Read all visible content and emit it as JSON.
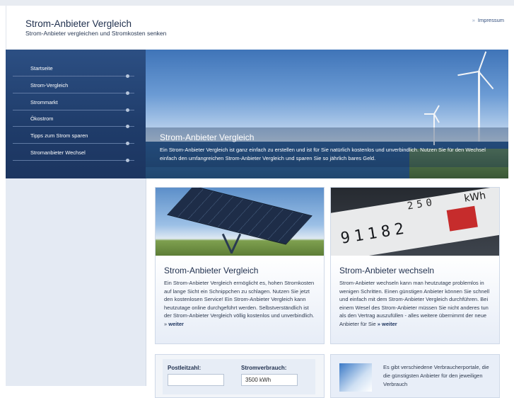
{
  "header": {
    "title": "Strom-Anbieter Vergleich",
    "subtitle": "Strom-Anbieter vergleichen und Stromkosten senken",
    "impressum_arrow": "»",
    "impressum": "Impressum"
  },
  "nav": {
    "items": [
      {
        "label": "Startseite"
      },
      {
        "label": "Strom-Vergleich"
      },
      {
        "label": "Strommarkt"
      },
      {
        "label": "Ökostrom"
      },
      {
        "label": "Tipps zum Strom sparen"
      },
      {
        "label": "Stromanbieter Wechsel"
      }
    ]
  },
  "hero": {
    "title": "Strom-Anbieter Vergleich",
    "text": "Ein Strom-Anbieter Vergleich ist ganz einfach zu erstellen und ist für Sie natürlich kostenlos und unverbindlich. Nutzen Sie für den Wechsel einfach den umfangreichen Strom-Anbieter Vergleich und sparen Sie so jährlich bares Geld."
  },
  "cards": [
    {
      "title": "Strom-Anbieter Vergleich",
      "text": "Ein Strom-Anbieter Vergleich ermöglicht es, hohen Stromkosten auf lange Sicht ein Schnippchen zu schlagen. Nutzen Sie jetzt den kostenlosen Service! Ein Strom-Anbieter Vergleich kann heutzutage online durchgeführt werden. Selbstverständlich ist der Strom-Anbieter Vergleich völlig kostenlos und unverbindlich. »",
      "more": "weiter"
    },
    {
      "title": "Strom-Anbieter wechseln",
      "text": "Strom-Anbieter wechseln kann man heutzutage problemlos in wenigen Schritten. Einen günstigen Anbieter können Sie schnell und einfach mit dem Strom-Anbieter Vergleich durchführen. Bei einem Wesel des Strom-Anbieter müssen Sie nicht anderes tun als den Vertrag auszufüllen - alles weitere übernimmt der neue Anbieter für Sie",
      "more": "» weiter",
      "meter_top": "250",
      "meter_digits": "91182",
      "meter_unit": "kWh"
    }
  ],
  "form": {
    "plz_label": "Postleitzahl:",
    "plz_value": "",
    "usage_label": "Stromverbrauch:",
    "usage_value": "3500 kWh"
  },
  "info": {
    "text": "Es gibt verschiedene Verbraucherportale, die die günstigsten Anbieter für den jeweiligen Verbrauch"
  }
}
